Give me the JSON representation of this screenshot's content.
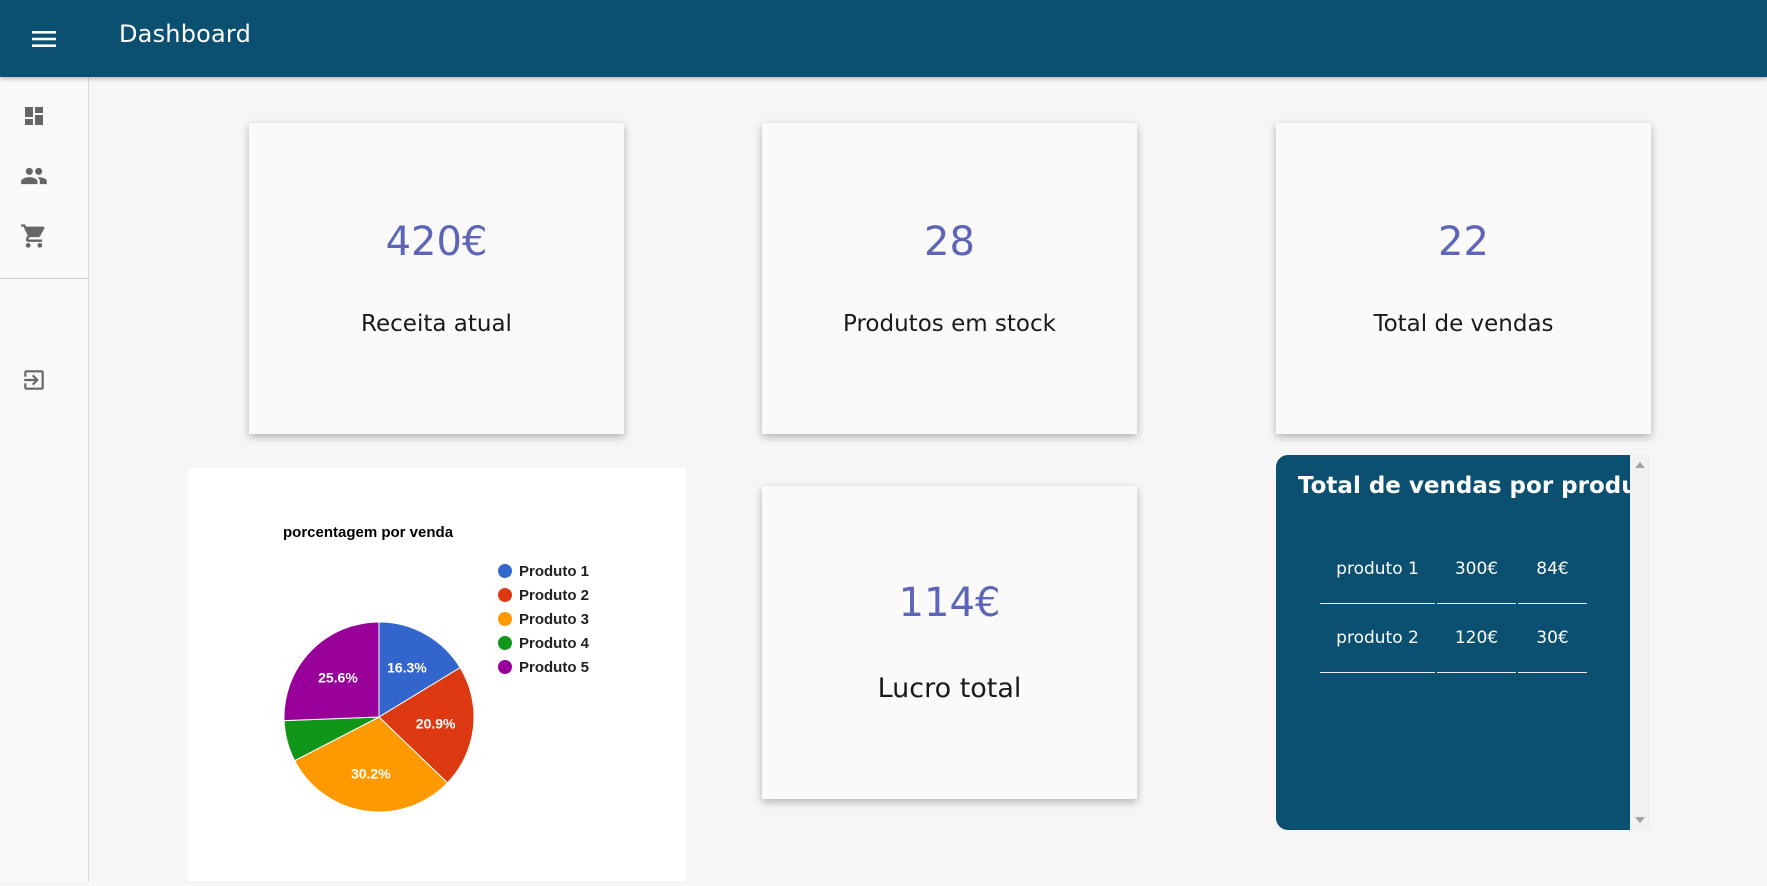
{
  "header": {
    "title": "Dashboard",
    "menu_icon": "menu-icon"
  },
  "colors": {
    "header": "#0b4f71",
    "accent_value": "#5e64b8",
    "panel": "#0b4f71"
  },
  "sidebar": {
    "items": [
      {
        "icon": "dashboard-icon"
      },
      {
        "icon": "people-icon"
      },
      {
        "icon": "cart-icon"
      },
      {
        "icon": "logout-icon"
      }
    ]
  },
  "stats": {
    "revenue": {
      "value": "420€",
      "label": "Receita atual"
    },
    "stock": {
      "value": "28",
      "label": "Produtos em stock"
    },
    "sales": {
      "value": "22",
      "label": "Total de vendas"
    },
    "profit": {
      "value": "114€",
      "label": "Lucro total"
    }
  },
  "chart_data": {
    "type": "pie",
    "title": "porcentagem por venda",
    "legend_position": "right",
    "categories": [
      "Produto 1",
      "Produto 2",
      "Produto 3",
      "Produto 4",
      "Produto 5"
    ],
    "values": [
      16.3,
      20.9,
      30.2,
      7.0,
      25.6
    ],
    "labels": [
      "16.3%",
      "20.9%",
      "30.2%",
      "",
      "25.6%"
    ],
    "colors": [
      "#3366cc",
      "#dc3912",
      "#ff9900",
      "#109618",
      "#990099"
    ]
  },
  "sales_by_product": {
    "title": "Total de vendas por produto:",
    "rows": [
      [
        "produto 1",
        "300€",
        "84€"
      ],
      [
        "produto 2",
        "120€",
        "30€"
      ]
    ]
  }
}
